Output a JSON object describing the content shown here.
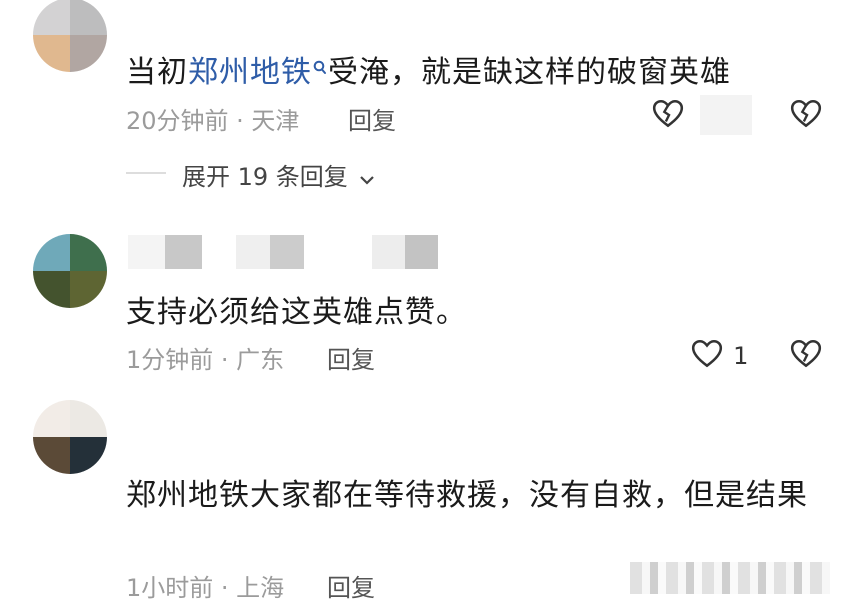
{
  "comments": [
    {
      "text_prefix": "当初",
      "text_link": "郑州地铁",
      "text_suffix": "受淹，就是缺这样的破窗英雄",
      "time_location": "20分钟前 · 天津",
      "reply_label": "回复"
    },
    {
      "text": "支持必须给这英雄点赞。",
      "time_location": "1分钟前 · 广东",
      "reply_label": "回复",
      "like_count": "1"
    },
    {
      "text": "郑州地铁大家都在等待救援，没有自救，但是结果",
      "time_location": "1小时前 · 上海",
      "reply_label": "回复"
    }
  ],
  "expand_replies_label": "展开 19 条回复"
}
